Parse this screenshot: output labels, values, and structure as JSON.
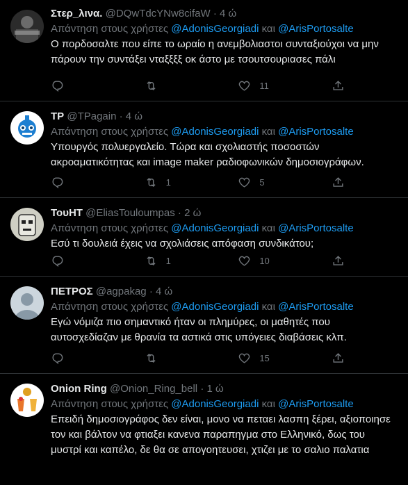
{
  "reply_prefix": "Απάντηση στους χρήστες",
  "reply_conjunction": "και",
  "reply_mention_1": "@AdonisGeorgiadi",
  "reply_mention_2": "@ArisPortosalte",
  "tweets": [
    {
      "name": "Στερ_λινα.",
      "handle": "@DQwTdcYNw8cifaW",
      "time": "· 4 ώ",
      "text": "Ο πορδοσαλτε που είπε το ωραίο η ανεμβολιαστοι  συνταξιούχοι να μην πάρουν την συντάξει  νταξξξξ οκ άστο με τσουτσουριασες πάλι",
      "replies": "",
      "retweets": "",
      "likes": "11"
    },
    {
      "name": "TP",
      "handle": "@TPagain",
      "time": "· 4 ώ",
      "text": "Υπουργός πολυεργαλείο. Τώρα και σχολιαστής ποσοστών ακροαματικότητας και image maker ραδιοφωνικών δημοσιογράφων.",
      "replies": "",
      "retweets": "1",
      "likes": "5"
    },
    {
      "name": "ΤουΗΤ",
      "handle": "@EliasTouloumpas",
      "time": "· 2 ώ",
      "text": "Εσύ τι δουλειά έχεις να σχολιάσεις απόφαση συνδικάτου;",
      "replies": "",
      "retweets": "1",
      "likes": "10"
    },
    {
      "name": "ΠΕΤΡΟΣ",
      "handle": "@agpakag",
      "time": "· 4 ώ",
      "text": "Εγώ νόμιζα πιο σημαντικό ήταν οι πλημύρες, οι μαθητές που αυτοσχεδίαζαν με θρανία τα αστικά στις υπόγειες διαβάσεις κλπ.",
      "replies": "",
      "retweets": "",
      "likes": "15"
    },
    {
      "name": "Onion Ring",
      "handle": "@Onion_Ring_bell",
      "time": "· 1 ώ",
      "text": "Επειδή δημοσιογράφος δεν είναι, μονο να πεταει λασπη ξέρει, αξιοποιησε τον και βάλτον να φτιαξει κανενα παραπηγμα στο Ελληνικό, δως του μυστρί και καπέλο, δε θα σε απογοητευσει, χτιζει με το σαλιο παλατια",
      "replies": "",
      "retweets": "",
      "likes": ""
    }
  ],
  "colors": {
    "background": "#000000",
    "text": "#e7e9ea",
    "muted": "#71767b",
    "link": "#1d9bf0",
    "divider": "#2f3336"
  },
  "icons": [
    "reply-icon",
    "retweet-icon",
    "like-icon",
    "share-icon"
  ]
}
